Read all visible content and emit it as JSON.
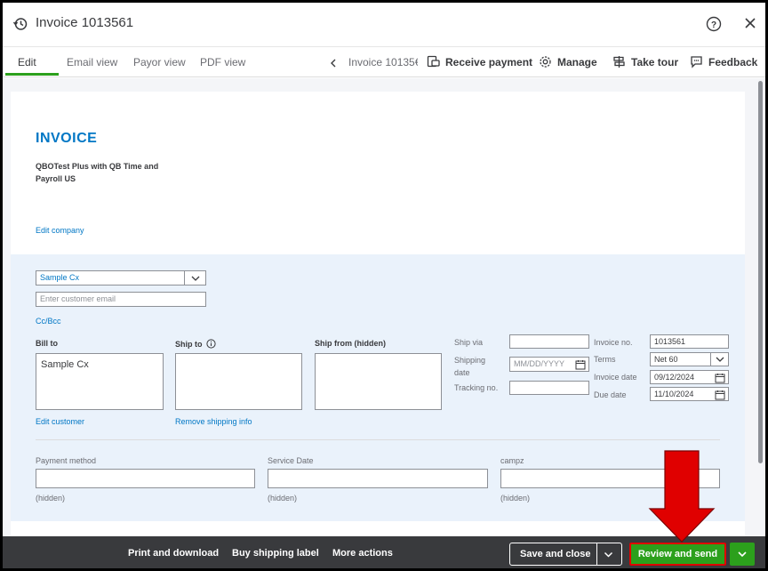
{
  "window": {
    "title": "Invoice 1013561"
  },
  "tabs": [
    {
      "label": "Edit"
    },
    {
      "label": "Email view"
    },
    {
      "label": "Payor view"
    },
    {
      "label": "PDF view"
    }
  ],
  "nav": {
    "invoice_label": "Invoice 10135€"
  },
  "toolbar": {
    "receive_payment": "Receive payment",
    "manage": "Manage",
    "take_tour": "Take tour",
    "feedback": "Feedback"
  },
  "invoice": {
    "heading": "INVOICE",
    "company_line1": "QBOTest Plus with QB Time and",
    "company_line2": "Payroll US",
    "edit_company": "Edit company"
  },
  "customer": {
    "selected": "Sample Cx",
    "email_placeholder": "Enter customer email",
    "cc_bcc": "Cc/Bcc"
  },
  "addresses": {
    "bill_to_label": "Bill to",
    "bill_to_value": "Sample Cx",
    "ship_to_label": "Ship to",
    "ship_from_label": "Ship from (hidden)",
    "edit_customer": "Edit customer",
    "remove_shipping": "Remove shipping info"
  },
  "shipping": {
    "ship_via_label": "Ship via",
    "shipping_date_label_1": "Shipping",
    "shipping_date_label_2": "date",
    "shipping_date_placeholder": "MM/DD/YYYY",
    "tracking_label": "Tracking no."
  },
  "details": {
    "invoice_no_label": "Invoice no.",
    "invoice_no": "1013561",
    "terms_label": "Terms",
    "terms": "Net 60",
    "invoice_date_label": "Invoice date",
    "invoice_date": "09/12/2024",
    "due_date_label": "Due date",
    "due_date": "11/10/2024"
  },
  "custom_fields": [
    {
      "label": "Payment method",
      "note": "(hidden)"
    },
    {
      "label": "Service Date",
      "note": "(hidden)"
    },
    {
      "label": "campz",
      "note": "(hidden)"
    }
  ],
  "footer": {
    "print_download": "Print and download",
    "buy_shipping": "Buy shipping label",
    "more_actions": "More actions",
    "save_close": "Save and close",
    "review_send": "Review and send"
  },
  "colors": {
    "brand_green": "#2ca01c",
    "link_blue": "#0077c5",
    "footer_bg": "#393a3d",
    "highlight_red": "#e00000"
  }
}
